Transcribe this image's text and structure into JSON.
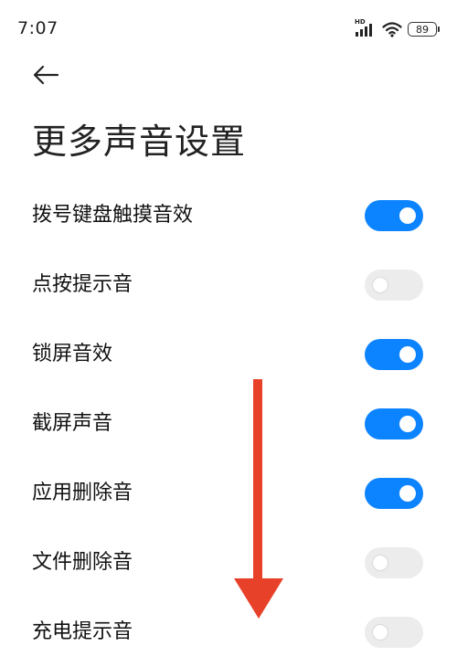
{
  "status_bar": {
    "time": "7:07",
    "network_label": "HD",
    "battery": "89"
  },
  "header": {
    "title": "更多声音设置"
  },
  "settings": [
    {
      "label": "拨号键盘触摸音效",
      "enabled": true
    },
    {
      "label": "点按提示音",
      "enabled": false
    },
    {
      "label": "锁屏音效",
      "enabled": true
    },
    {
      "label": "截屏声音",
      "enabled": true
    },
    {
      "label": "应用删除音",
      "enabled": true
    },
    {
      "label": "文件删除音",
      "enabled": false
    },
    {
      "label": "充电提示音",
      "enabled": false
    }
  ],
  "colors": {
    "toggle_on": "#0d84ff",
    "toggle_off": "#ececec",
    "annotation_arrow": "#e8412a"
  }
}
